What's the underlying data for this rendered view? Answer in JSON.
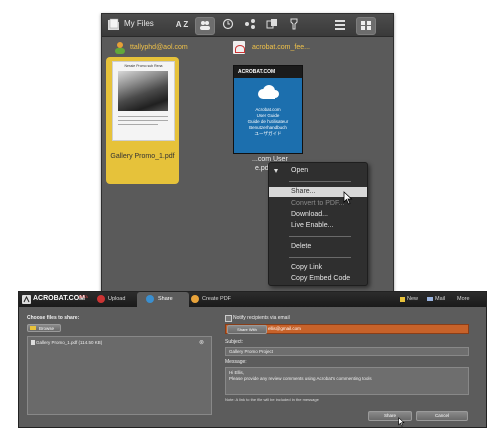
{
  "files_window": {
    "title": "My Files",
    "sort_label": "A Z",
    "items": [
      {
        "owner": "ttallyphd@aol.com",
        "doc_title": "Nessie Promo sub Rena",
        "file_name": "Gallery Promo_1.pdf"
      },
      {
        "owner": "acrobat.com_fee...",
        "logo": "ACROBAT.COM",
        "doc_lines": [
          "Acrobat.com",
          "User Guide",
          "Guide de l'utilisateur",
          "Benutzerhandbuch",
          "ユーザガイド"
        ],
        "file_name_lines": [
          "...com User",
          "e.pdf"
        ]
      }
    ]
  },
  "context_menu": {
    "items": [
      {
        "label": "Open",
        "state": "normal"
      },
      {
        "label": "Share...",
        "state": "highlighted"
      },
      {
        "label": "Convert to PDF...",
        "state": "disabled"
      },
      {
        "label": "Download...",
        "state": "normal"
      },
      {
        "label": "Live Enable...",
        "state": "normal"
      },
      {
        "label": "Delete",
        "state": "normal"
      },
      {
        "label": "Copy Link",
        "state": "normal"
      },
      {
        "label": "Copy Embed Code",
        "state": "normal"
      }
    ]
  },
  "share_window": {
    "logo": "ACROBAT.COM",
    "logo_badge": "BETA",
    "tabs": [
      "Upload",
      "Share",
      "Create PDF"
    ],
    "right_menu": [
      "New",
      "Mail",
      "More"
    ],
    "left": {
      "label": "Choose files to share:",
      "browse_label": "Browse",
      "file_entry": "Gallery Promo_1.pdf (114.50 KB)"
    },
    "right": {
      "notify_label": "Notify recipients via email",
      "share_with_button": "Share With",
      "recipient": "ellis@gmail.com",
      "subject_label": "Subject:",
      "subject": "Gallery Promo Project",
      "message_label": "Message:",
      "message_line1": "Hi Ellis,",
      "message_line2": "Please provide any review comments using Acrobat's commenting tools",
      "note": "Note: A link to the file will be included in the message",
      "share_button": "Share",
      "cancel_button": "Cancel"
    }
  },
  "colors": {
    "selection": "#e6c23a",
    "owner_text": "#f0c24a",
    "menu_bg": "#2f2f2f",
    "acrobat_blue": "#1c6fae",
    "recipient_field": "#c7622a"
  }
}
